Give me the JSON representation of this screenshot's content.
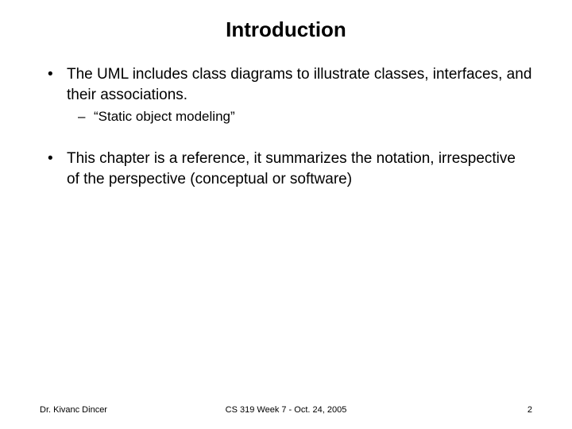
{
  "title": "Introduction",
  "bullets": [
    {
      "text": "The UML includes class diagrams to illustrate classes, interfaces, and their associations.",
      "children": [
        {
          "text": "“Static object modeling”"
        }
      ]
    },
    {
      "text": "This chapter is a reference, it summarizes the notation, irrespective of the perspective (conceptual or software)",
      "children": []
    }
  ],
  "footer": {
    "left": "Dr. Kivanc Dincer",
    "center": "CS 319 Week 7 - Oct. 24, 2005",
    "right": "2"
  }
}
